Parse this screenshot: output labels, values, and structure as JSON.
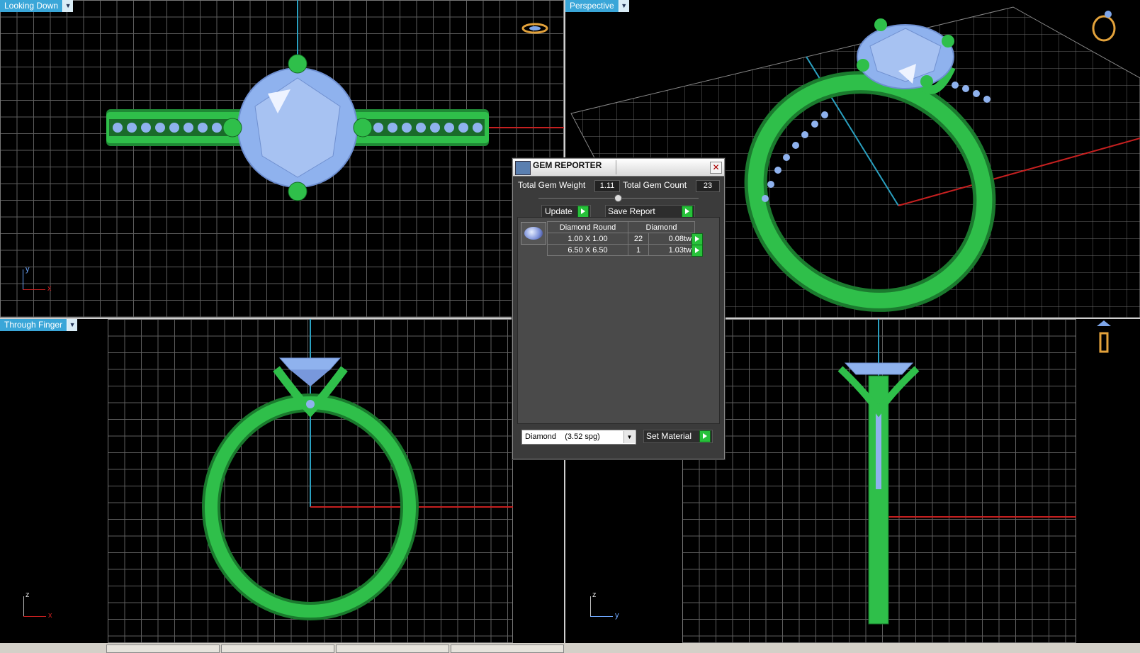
{
  "viewports": {
    "top_left": {
      "label": "Looking Down",
      "axis_v": "y",
      "axis_h": "x"
    },
    "top_right": {
      "label": "Perspective"
    },
    "bottom_left": {
      "label": "Through Finger",
      "axis_v": "z",
      "axis_h": "x"
    },
    "bottom_right": {
      "axis_v": "z",
      "axis_h": "y"
    }
  },
  "gem_reporter": {
    "title": "GEM REPORTER",
    "total_gem_weight_label": "Total Gem Weight",
    "total_gem_weight": "1.11",
    "total_gem_count_label": "Total Gem Count",
    "total_gem_count": "23",
    "update_label": "Update",
    "save_report_label": "Save Report",
    "table": {
      "header_shape": "Diamond Round",
      "header_material": "Diamond",
      "rows": [
        {
          "size": "1.00 X 1.00",
          "count": "22",
          "weight": "0.08tw"
        },
        {
          "size": "6.50 X 6.50",
          "count": "1",
          "weight": "1.03tw"
        }
      ]
    },
    "material_select": "Diamond    (3.52 spg)",
    "set_material_label": "Set Material"
  },
  "colors": {
    "metal": "#2fbf4a",
    "gem": "#8fb2ee",
    "axis_red": "#c62020",
    "axis_cyan": "#2aa0c0",
    "label_bg": "#3aa6d8"
  }
}
